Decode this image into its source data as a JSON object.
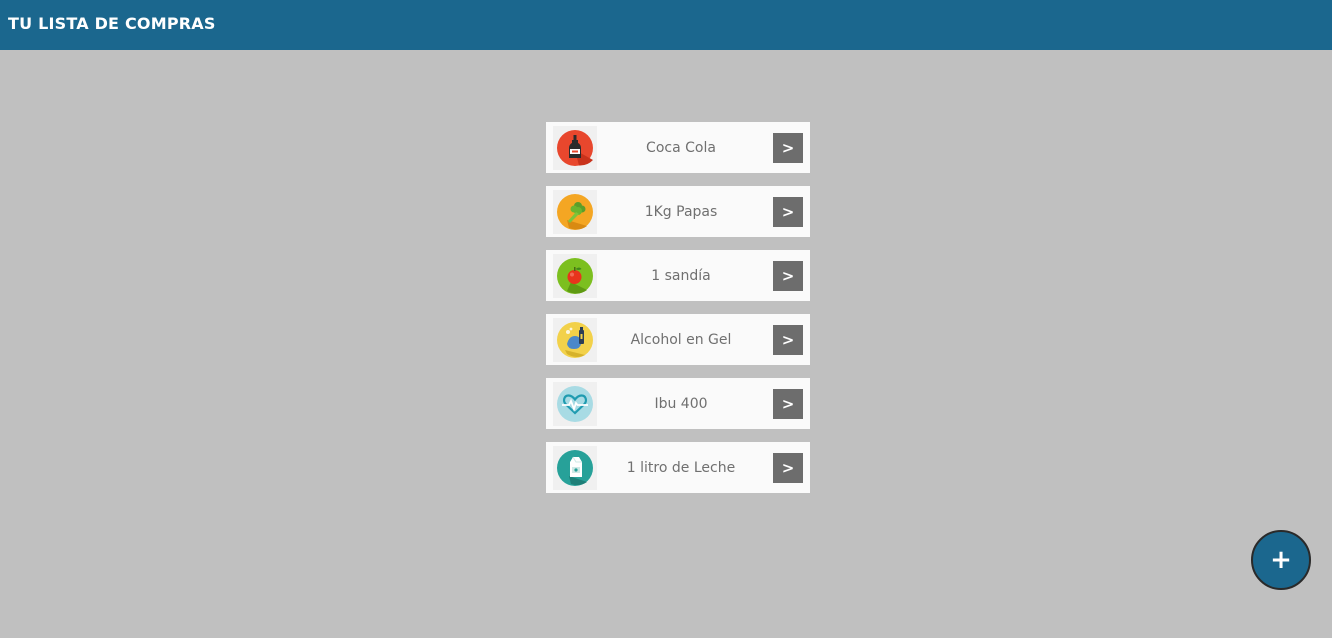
{
  "header": {
    "title": "TU LISTA DE COMPRAS",
    "color": "#1b678e"
  },
  "items": [
    {
      "label": "Coca Cola",
      "icon": "soda-bottle-icon",
      "icon_color": "#e8472d",
      "button_label": ">"
    },
    {
      "label": "1Kg Papas",
      "icon": "vegetable-icon",
      "icon_color": "#f4a623",
      "button_label": ">"
    },
    {
      "label": "1 sandía",
      "icon": "fruit-icon",
      "icon_color": "#7cbf1f",
      "button_label": ">"
    },
    {
      "label": "Alcohol en Gel",
      "icon": "sanitizer-icon",
      "icon_color": "#f2d14a",
      "button_label": ">"
    },
    {
      "label": "Ibu 400",
      "icon": "heartbeat-icon",
      "icon_color": "#a8dbe4",
      "button_label": ">"
    },
    {
      "label": "1 litro de Leche",
      "icon": "milk-carton-icon",
      "icon_color": "#27a199",
      "button_label": ">"
    }
  ],
  "fab": {
    "label": "+"
  }
}
